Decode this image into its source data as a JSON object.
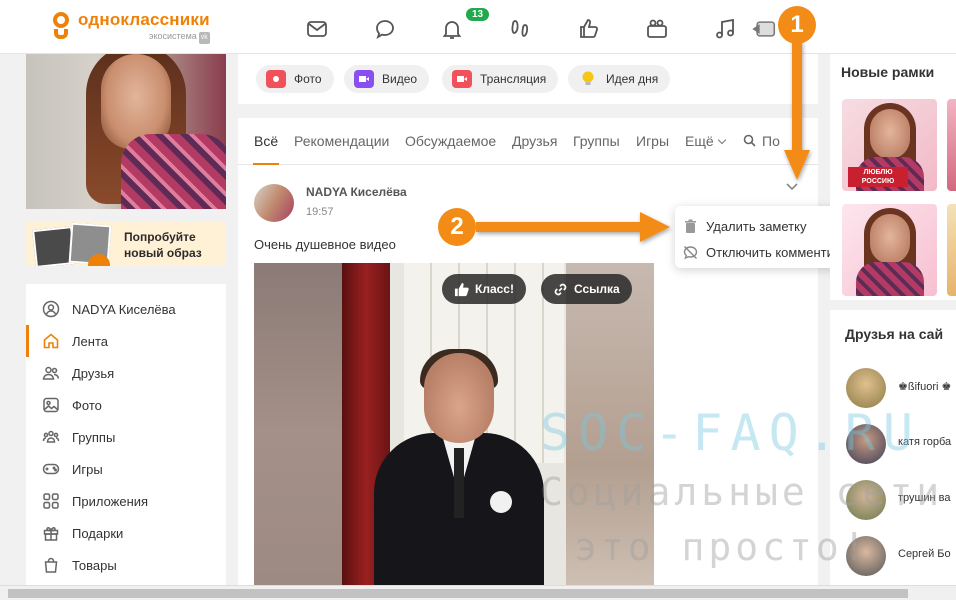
{
  "header": {
    "logo_name": "одноклассники",
    "logo_sub": "экосистема",
    "logo_vk": "vk",
    "notifications_count": "13"
  },
  "sidebar": {
    "promo_text_1": "Попробуйте",
    "promo_text_2": "новый образ",
    "items": [
      {
        "label": "NADYA Киселёва",
        "icon": "user-icon"
      },
      {
        "label": "Лента",
        "icon": "home-icon"
      },
      {
        "label": "Друзья",
        "icon": "friends-icon"
      },
      {
        "label": "Фото",
        "icon": "photo-icon"
      },
      {
        "label": "Группы",
        "icon": "groups-icon"
      },
      {
        "label": "Игры",
        "icon": "gamepad-icon"
      },
      {
        "label": "Приложения",
        "icon": "apps-icon"
      },
      {
        "label": "Подарки",
        "icon": "gift-icon"
      },
      {
        "label": "Товары",
        "icon": "bag-icon"
      }
    ]
  },
  "composer": {
    "photo": "Фото",
    "video": "Видео",
    "stream": "Трансляция",
    "idea": "Идея дня"
  },
  "feed": {
    "tabs": [
      "Всё",
      "Рекомендации",
      "Обсуждаемое",
      "Друзья",
      "Группы",
      "Игры",
      "Ещё"
    ],
    "search_label": "По",
    "post": {
      "author": "NADYA Киселёва",
      "time": "19:57",
      "text": "Очень душевное видео",
      "like_btn": "Класс!",
      "link_btn": "Ссылка"
    }
  },
  "dropdown": {
    "delete": "Удалить заметку",
    "disable_comments": "Отключить комментирование"
  },
  "right": {
    "frames_title": "Новые рамки",
    "frame_label": "ЛЮБЛЮ РОССИЮ",
    "friends_title": "Друзья на сай",
    "friends": [
      {
        "name": "♚ßifuori ♚"
      },
      {
        "name": "катя горба"
      },
      {
        "name": "трушин ва"
      },
      {
        "name": "Сергей Бо"
      }
    ]
  },
  "watermark": {
    "line1": "SOC-FAQ.RU",
    "line2": "Социальные сети",
    "line3": "это просто!"
  },
  "annotations": {
    "step1": "1",
    "step2": "2"
  },
  "colors": {
    "brand": "#ee8208",
    "annotation": "#f28c17",
    "badge": "#22a94d"
  }
}
